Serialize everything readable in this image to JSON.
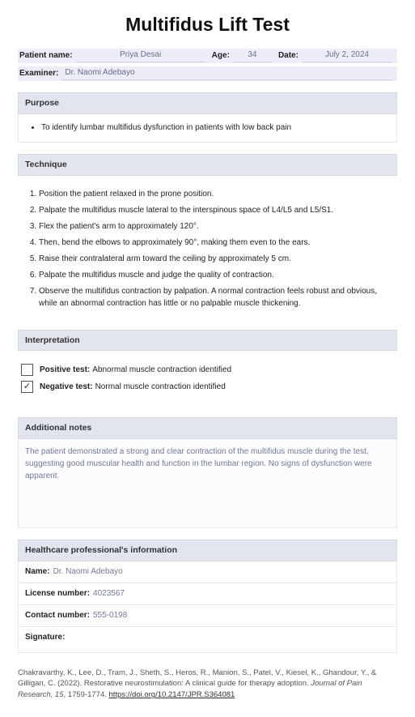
{
  "title": "Multifidus Lift Test",
  "header": {
    "patient_label": "Patient name:",
    "patient_value": "Priya Desai",
    "age_label": "Age:",
    "age_value": "34",
    "date_label": "Date:",
    "date_value": "July 2, 2024",
    "examiner_label": "Examiner:",
    "examiner_value": "Dr. Naomi Adebayo"
  },
  "purpose": {
    "heading": "Purpose",
    "items": [
      "To identify lumbar multifidus dysfunction in patients with low back pain"
    ]
  },
  "technique": {
    "heading": "Technique",
    "steps": [
      "Position the patient relaxed in the prone position.",
      "Palpate the multifidus muscle lateral to the interspinous space of L4/L5 and L5/S1.",
      "Flex the patient's arm to approximately 120°.",
      "Then, bend the elbows to approximately 90°, making them even to the ears.",
      "Raise their contralateral arm toward the ceiling by approximately 5 cm.",
      "Palpate the multifidus muscle and judge the quality of contraction.",
      "Observe the multifidus contraction by palpation. A normal contraction feels robust and obvious, while an abnormal contraction has little or no palpable muscle thickening."
    ]
  },
  "interpretation": {
    "heading": "Interpretation",
    "positive_label": "Positive test:",
    "positive_desc": "Abnormal muscle contraction identified",
    "positive_checked": false,
    "negative_label": "Negative test:",
    "negative_desc": "Normal muscle contraction identified",
    "negative_checked": true
  },
  "notes": {
    "heading": "Additional notes",
    "text": "The patient demonstrated a strong and clear contraction of the multifidus muscle during the test, suggesting good muscular health and function in the lumbar region. No signs of dysfunction were apparent."
  },
  "hp": {
    "heading": "Healthcare professional's information",
    "name_label": "Name:",
    "name_value": "Dr. Naomi Adebayo",
    "license_label": "License number:",
    "license_value": "4023567",
    "contact_label": "Contact number:",
    "contact_value": "555-0198",
    "signature_label": "Signature:"
  },
  "citation": {
    "authors": "Chakravarthy, K., Lee, D., Tram, J., Sheth, S., Heros, R., Manion, S., Patel, V., Kiesel, K., Ghandour, Y., & Gilligan, C. (2022). Restorative neurostimulation: A clinical guide for therapy adoption. ",
    "journal": "Journal of Pain Research, 15",
    "pages": ", 1759-1774. ",
    "link_text": "https://doi.org/10.2147/JPR.S364081"
  }
}
